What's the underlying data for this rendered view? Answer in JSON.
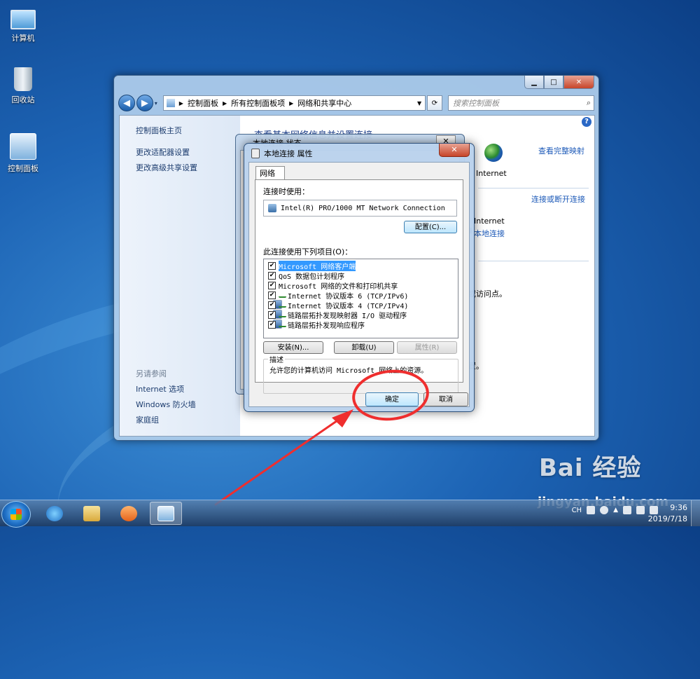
{
  "desktop": {
    "icons": [
      {
        "label": "计算机"
      },
      {
        "label": "回收站"
      },
      {
        "label": "控制面板"
      }
    ]
  },
  "explorer": {
    "address": [
      "控制面板",
      "所有控制面板项",
      "网络和共享中心"
    ],
    "search_placeholder": "搜索控制面板",
    "left_pane": {
      "home": "控制面板主页",
      "links": [
        "更改适配器设置",
        "更改高级共享设置"
      ],
      "see_also_header": "另请参阅",
      "see_also": [
        "Internet 选项",
        "Windows 防火墙",
        "家庭组"
      ]
    },
    "main": {
      "title": "查看基本网络信息并设置连接",
      "view_full_map": "查看完整映射",
      "internet_label": "Internet",
      "connect_disconnect": "连接或断开连接",
      "access_type_value": "Internet",
      "connection_link": "本地连接",
      "fragment_1": "或访问点。",
      "fragment_2": "置。"
    }
  },
  "status_dialog": {
    "title": "本地连接 状态"
  },
  "properties_dialog": {
    "title": "本地连接 属性",
    "tab": "网络",
    "connect_using_label": "连接时使用：",
    "adapter": "Intel(R) PRO/1000 MT Network Connection",
    "configure_button": "配置(C)...",
    "items_label": "此连接使用下列项目(O)：",
    "items": [
      {
        "label": "Microsoft 网络客户端",
        "checked": true,
        "icon": "network-client-icon"
      },
      {
        "label": "QoS 数据包计划程序",
        "checked": true,
        "icon": "service-icon"
      },
      {
        "label": "Microsoft 网络的文件和打印机共享",
        "checked": true,
        "icon": "service-icon"
      },
      {
        "label": "Internet 协议版本 6 (TCP/IPv6)",
        "checked": true,
        "icon": "protocol-icon"
      },
      {
        "label": "Internet 协议版本 4 (TCP/IPv4)",
        "checked": true,
        "icon": "protocol-icon"
      },
      {
        "label": "链路层拓扑发现映射器 I/O 驱动程序",
        "checked": true,
        "icon": "protocol-icon"
      },
      {
        "label": "链路层拓扑发现响应程序",
        "checked": true,
        "icon": "protocol-icon"
      }
    ],
    "install_button": "安装(N)...",
    "uninstall_button": "卸载(U)",
    "properties_button": "属性(R)",
    "description_header": "描述",
    "description_text": "允许您的计算机访问 Microsoft 网络上的资源。",
    "ok_button": "确定",
    "cancel_button": "取消"
  },
  "taskbar": {
    "language": "CH",
    "time": "9:36",
    "date": "2019/7/18"
  },
  "watermark": {
    "brand": "Bai 经验",
    "url": "jingyan.baidu.com"
  },
  "colors": {
    "annotation_red": "#ef2e2e",
    "link_blue": "#1d5ab8",
    "selection": "#3399ff"
  }
}
